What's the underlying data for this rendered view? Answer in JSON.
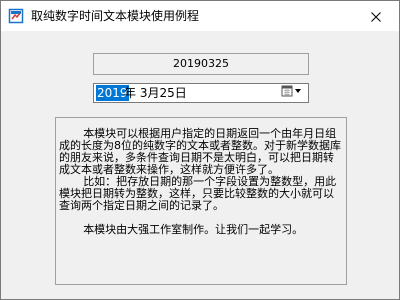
{
  "window": {
    "title": "取纯数字时间文本模块使用例程"
  },
  "date_readout": {
    "value": "20190325"
  },
  "date_picker": {
    "year": "2019",
    "rest": "年  3月25日"
  },
  "description": {
    "paragraphs": [
      "本模块可以根据用户指定的日期返回一个由年月日组成的长度为8位的纯数字的文本或者整数。对于新学数据库的朋友来说，多条件查询日期不是太明白，可以把日期转成文本或者整数来操作，这样就方便许多了。",
      "比如：把存放日期的那一个字段设置为整数型，用此模块把日期转为整数，这样，只要比较整数的大小就可以查询两个指定日期之间的记录了。",
      "本模块由大强工作室制作。让我们一起学习。"
    ]
  },
  "colors": {
    "selection": "#0078d7",
    "window_bg": "#f0f0f0"
  },
  "icons": {
    "app": "app-icon",
    "close": "close-icon",
    "calendar_dropdown": "calendar-dropdown-icon"
  }
}
